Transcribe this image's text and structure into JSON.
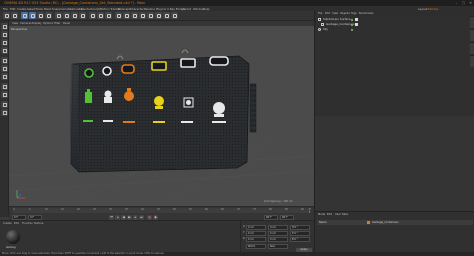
{
  "window": {
    "title": "CINEMA 4D R17.053 Studio (RC) - [Garbage_Containers_Set_Standard.c4d *] - Main",
    "controls": [
      "–",
      "□",
      "✕"
    ]
  },
  "menubar": {
    "items": [
      "File",
      "Edit",
      "Create",
      "Select",
      "Tools",
      "Mesh",
      "Snap",
      "Animate",
      "Simulate",
      "Render",
      "Sculpt",
      "Motion Tracker",
      "MoGraph",
      "Character",
      "Pipeline",
      "Plugins",
      "V-Ray Bridge",
      "Script",
      "Window",
      "Help",
      "Layout:",
      "Startup"
    ]
  },
  "viewport": {
    "menu": [
      "View",
      "Cameras",
      "Display",
      "Options",
      "Filter",
      "Panel"
    ],
    "label": "Perspective",
    "grid_spacing": "Grid Spacing : 100 cm"
  },
  "timeline": {
    "ticks": [
      "0",
      "5",
      "10",
      "15",
      "20",
      "25",
      "30",
      "35",
      "40",
      "45",
      "50",
      "55",
      "60",
      "65",
      "70",
      "75",
      "80",
      "85",
      "90"
    ],
    "start_field": "0 F",
    "current_field": "0 F",
    "end_field": "90 F",
    "end_field2": "90 F",
    "frame_readout": "0 F"
  },
  "materials": {
    "menu": [
      "Create",
      "Edit",
      "Function",
      "Texture"
    ],
    "material_name": "Garbag"
  },
  "coordinates": {
    "rows": [
      {
        "label": "X",
        "pos": "0 cm",
        "size": "0 cm",
        "rot": "H 0 °"
      },
      {
        "label": "Y",
        "pos": "0 cm",
        "size": "0 cm",
        "rot": "P 0 °"
      },
      {
        "label": "Z",
        "pos": "0 cm",
        "size": "0 cm",
        "rot": "B 0 °"
      }
    ],
    "mode_left": "World",
    "mode_right": "Size",
    "apply": "Apply"
  },
  "object_manager": {
    "menu": [
      "File",
      "Edit",
      "View",
      "Objects",
      "Tags",
      "Bookmarks"
    ],
    "objects": [
      {
        "name": "Subdivision Surface",
        "dot_color": "#7fbf5a"
      },
      {
        "name": "Garbage_Containers",
        "dot_color": "#7fbf5a"
      },
      {
        "name": "Sky",
        "dot_color": "#7fbf5a"
      }
    ]
  },
  "attributes": {
    "menu": [
      "Mode",
      "Edit",
      "User Data"
    ],
    "layer_label": "Name",
    "layer_value": "Garbage_Containers"
  },
  "status": {
    "text": "Move: Click and drag to move elements. Hold down SHIFT to quantize movement / add to the selection in point mode, CTRL to remove."
  },
  "colors": {
    "accent": "#d87a1e",
    "light_green": "#52c234",
    "light_white": "#e8e8e8",
    "light_orange": "#e07b22",
    "light_yellow": "#e6d21c"
  }
}
